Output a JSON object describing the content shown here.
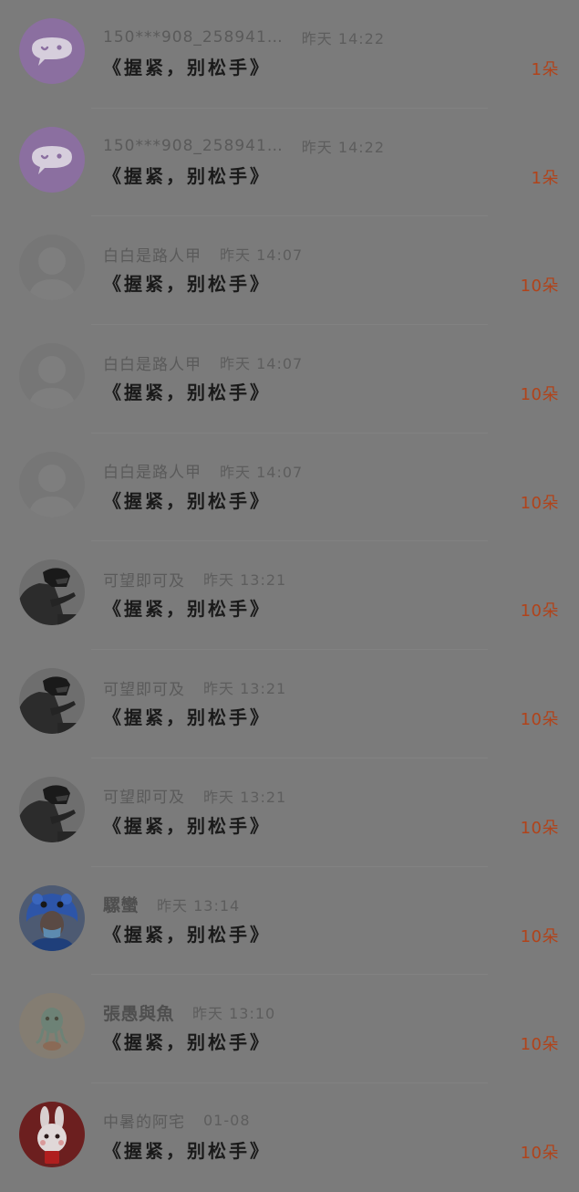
{
  "colors": {
    "overlay_background": "#7b7b7b",
    "count_accent": "#b1431a",
    "title_text": "#1a1a1a"
  },
  "gift_records": [
    {
      "user": "150***908_258941…",
      "time": "昨天 14:22",
      "gift": "《握紧，别松手》",
      "count": "1朵",
      "avatar": "wechat-bubble-icon"
    },
    {
      "user": "150***908_258941…",
      "time": "昨天 14:22",
      "gift": "《握紧，别松手》",
      "count": "1朵",
      "avatar": "wechat-bubble-icon"
    },
    {
      "user": "白白是路人甲",
      "time": "昨天 14:07",
      "gift": "《握紧，别松手》",
      "count": "10朵",
      "avatar": "default-user-icon"
    },
    {
      "user": "白白是路人甲",
      "time": "昨天 14:07",
      "gift": "《握紧，别松手》",
      "count": "10朵",
      "avatar": "default-user-icon"
    },
    {
      "user": "白白是路人甲",
      "time": "昨天 14:07",
      "gift": "《握紧，别松手》",
      "count": "10朵",
      "avatar": "default-user-icon"
    },
    {
      "user": "可望即可及",
      "time": "昨天 13:21",
      "gift": "《握紧，别松手》",
      "count": "10朵",
      "avatar": "helmet-rider-photo"
    },
    {
      "user": "可望即可及",
      "time": "昨天 13:21",
      "gift": "《握紧，别松手》",
      "count": "10朵",
      "avatar": "helmet-rider-photo"
    },
    {
      "user": "可望即可及",
      "time": "昨天 13:21",
      "gift": "《握紧，别松手》",
      "count": "10朵",
      "avatar": "helmet-rider-photo"
    },
    {
      "user": "騾蠻",
      "time": "昨天 13:14",
      "gift": "《握紧，别松手》",
      "count": "10朵",
      "avatar": "blue-costume-photo"
    },
    {
      "user": "張愚與魚",
      "time": "昨天 13:10",
      "gift": "《握紧，别松手》",
      "count": "10朵",
      "avatar": "cartoon-squid-icon"
    },
    {
      "user": "中暑的阿宅",
      "time": "01-08",
      "gift": "《握紧，别松手》",
      "count": "10朵",
      "avatar": "red-rabbit-icon"
    }
  ]
}
